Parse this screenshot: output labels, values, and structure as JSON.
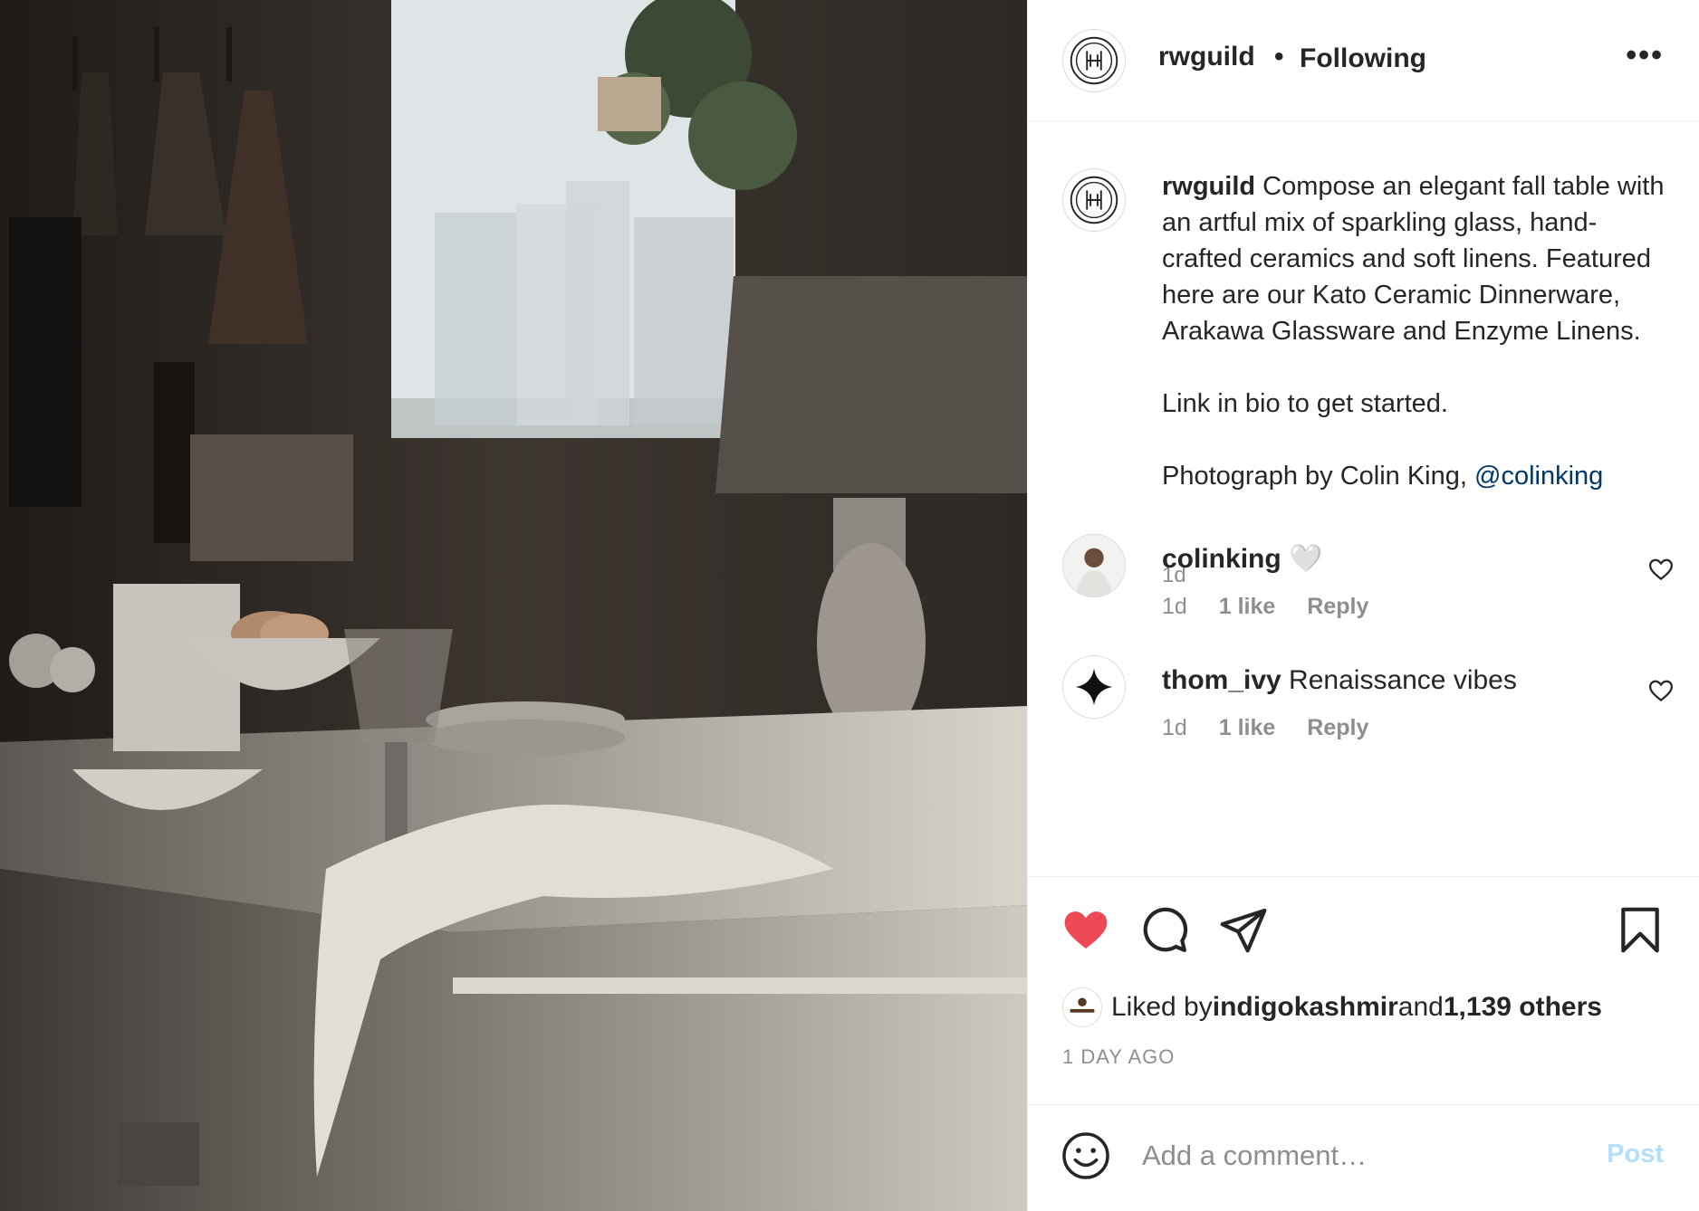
{
  "photo": {
    "alt": "post-photo"
  },
  "header": {
    "username": "rwguild",
    "separator": "•",
    "follow_status": "Following",
    "more": "•••"
  },
  "caption": {
    "username": "rwguild",
    "text": " Compose an elegant fall table with an artful mix of sparkling glass, hand-crafted ceramics and soft linens. Featured here are our Kato Ceramic Dinnerware, Arakawa Glassware and Enzyme Linens.",
    "link_line": "Link in bio to get started.",
    "credit": "Photograph by Colin King, ",
    "mention": "@colinking",
    "time": "1d"
  },
  "comments": [
    {
      "username": "colinking",
      "text": " 🤍",
      "time": "1d",
      "likes": "1 like",
      "reply": "Reply"
    },
    {
      "username": "thom_ivy",
      "text": " Renaissance vibes",
      "time": "1d",
      "likes": "1 like",
      "reply": "Reply"
    }
  ],
  "actions": {
    "icons": [
      "heart-filled-icon",
      "comment-icon",
      "share-icon",
      "bookmark-icon"
    ],
    "like_color": "#ed4956"
  },
  "likes": {
    "prefix": "Liked by ",
    "user": "indigokashmir",
    "middle": " and ",
    "count": "1,139 others"
  },
  "post_time": "1 DAY AGO",
  "add_comment": {
    "placeholder": "Add a comment…",
    "post_label": "Post"
  }
}
